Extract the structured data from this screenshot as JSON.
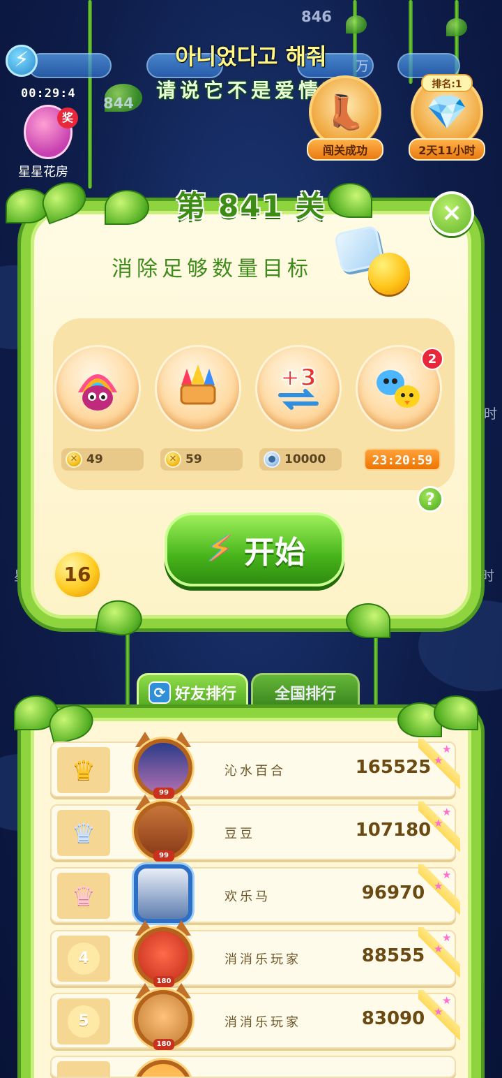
{
  "background": {
    "numbers": [
      "846",
      "844"
    ],
    "hud_timer": "00:29:4",
    "hud_counter": "万",
    "star_house": {
      "label": "星星花房",
      "badge": "奖"
    },
    "side_fragments": [
      "时",
      "时",
      "星"
    ]
  },
  "song": {
    "line1": "아니었다고 해줘",
    "line2": "请说它不是爱情吧"
  },
  "events": [
    {
      "label": "闯关成功",
      "icon": "boots-icon"
    },
    {
      "label": "2天11小时",
      "rank": "排名:1",
      "icon": "shield-icon"
    }
  ],
  "level_dialog": {
    "title": "第 841 关",
    "goal": "消除足够数量目标",
    "boosters": [
      {
        "icon": "rainbow-bird-icon",
        "price": "49",
        "currency": "coin"
      },
      {
        "icon": "firework-icon",
        "price": "59",
        "currency": "coin"
      },
      {
        "icon": "plus-three-moves-icon",
        "price": "10000",
        "currency": "silver-coin"
      },
      {
        "icon": "pet-friends-icon",
        "timer": "23:20:59",
        "badge": "2"
      }
    ],
    "start_label": "开始",
    "lives": "16",
    "help": "?",
    "close": "×"
  },
  "leaderboard": {
    "tabs": [
      {
        "label": "好友排行",
        "active": true
      },
      {
        "label": "全国排行",
        "active": false
      }
    ],
    "rows": [
      {
        "rank": "1",
        "name": "沁水百合",
        "score": "165525",
        "avatar_level": "99",
        "frame": "cat"
      },
      {
        "rank": "2",
        "name": "豆豆",
        "score": "107180",
        "avatar_level": "99",
        "frame": "cat"
      },
      {
        "rank": "3",
        "name": "欢乐马",
        "score": "96970",
        "avatar_level": "",
        "frame": "shield"
      },
      {
        "rank": "4",
        "name": "消消乐玩家",
        "score": "88555",
        "avatar_level": "180",
        "frame": "cat"
      },
      {
        "rank": "5",
        "name": "消消乐玩家",
        "score": "83090",
        "avatar_level": "180",
        "frame": "cat"
      }
    ]
  },
  "colors": {
    "vine_green": "#8ed43f",
    "panel_cream": "#fffbe4",
    "start_green": "#47b41b",
    "timer_orange": "#ee7400",
    "score_brown": "#6a4a12"
  }
}
